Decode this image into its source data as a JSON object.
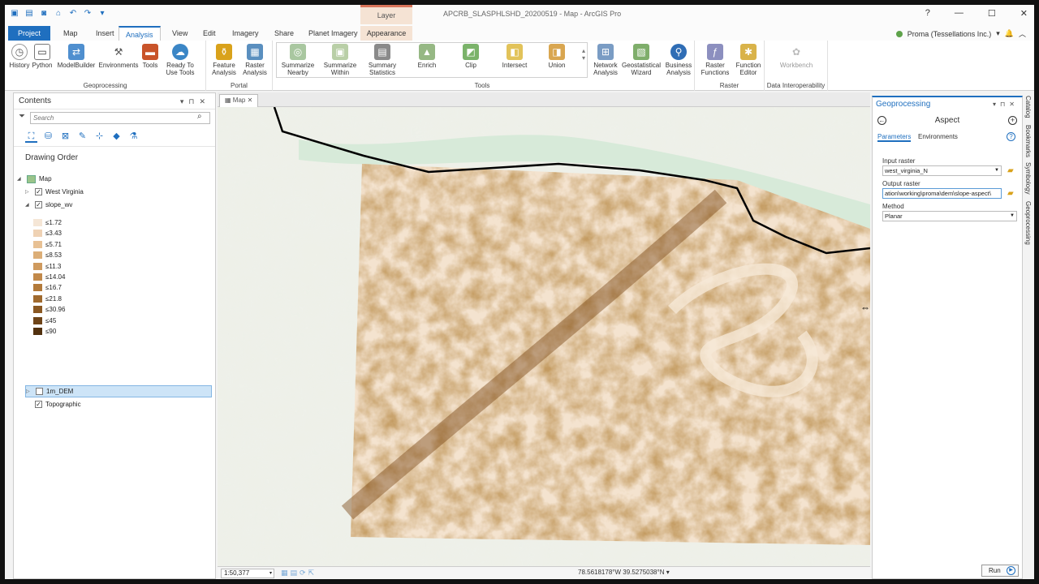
{
  "window": {
    "title": "APCRB_SLASPHLSHD_20200519 - Map - ArcGIS Pro",
    "context_header": "Layer",
    "controls": [
      "?",
      "—",
      "☐",
      "✕"
    ]
  },
  "tabs": {
    "project": "Project",
    "items": [
      "Map",
      "Insert",
      "Analysis",
      "View",
      "Edit",
      "Imagery",
      "Share",
      "Planet Imagery",
      "Appearance"
    ],
    "active": "Analysis"
  },
  "user": {
    "name": "Proma (Tessellations Inc.)"
  },
  "ribbon": {
    "geoprocessing": {
      "label": "Geoprocessing",
      "buttons": [
        "History",
        "Python",
        "ModelBuilder",
        "Environments",
        "Tools",
        "Ready To Use Tools"
      ]
    },
    "portal": {
      "label": "Portal",
      "buttons": [
        "Feature Analysis",
        "Raster Analysis"
      ]
    },
    "tools": {
      "label": "Tools",
      "buttons": [
        "Summarize Nearby",
        "Summarize Within",
        "Summary Statistics",
        "Enrich",
        "Clip",
        "Intersect",
        "Union"
      ]
    },
    "raster": {
      "label": "Raster",
      "buttons": [
        "Network Analysis",
        "Geostatistical Wizard",
        "Business Analysis",
        "Raster Functions",
        "Function Editor"
      ]
    },
    "interop": {
      "label": "Data Interoperability",
      "buttons": [
        "Workbench"
      ]
    }
  },
  "contents": {
    "title": "Contents",
    "search_placeholder": "Search",
    "drawing_order": "Drawing Order",
    "map_label": "Map",
    "layers": {
      "west_virginia": "West Virginia",
      "slope": "slope_wv",
      "dem": "1m_DEM",
      "topo": "Topographic"
    },
    "legend": [
      {
        "label": "≤1.72",
        "color": "#f5e6d6"
      },
      {
        "label": "≤3.43",
        "color": "#efd2b4"
      },
      {
        "label": "≤5.71",
        "color": "#e8c194"
      },
      {
        "label": "≤8.53",
        "color": "#dcae77"
      },
      {
        "label": "≤11.3",
        "color": "#cf9a5e"
      },
      {
        "label": "≤14.04",
        "color": "#c2894a"
      },
      {
        "label": "≤16.7",
        "color": "#b37a3a"
      },
      {
        "label": "≤21.8",
        "color": "#a06a2e"
      },
      {
        "label": "≤30.96",
        "color": "#8a5822"
      },
      {
        "label": "≤45",
        "color": "#6e4418"
      },
      {
        "label": "≤90",
        "color": "#52310f"
      }
    ]
  },
  "map": {
    "tab": "Map",
    "scale": "1:50,377",
    "coords": "78.5618178°W 39.5275038°N"
  },
  "geoprocessing": {
    "title": "Geoprocessing",
    "tool": "Aspect",
    "tabs": [
      "Parameters",
      "Environments"
    ],
    "params": {
      "input_label": "Input raster",
      "input_value": "west_virginia_N",
      "output_label": "Output raster",
      "output_value": "ation\\working\\proma\\dem\\slope-aspect\\",
      "method_label": "Method",
      "method_value": "Planar"
    },
    "run": "Run"
  },
  "sidetabs": [
    "Catalog",
    "Bookmarks",
    "Symbology",
    "Geoprocessing"
  ]
}
